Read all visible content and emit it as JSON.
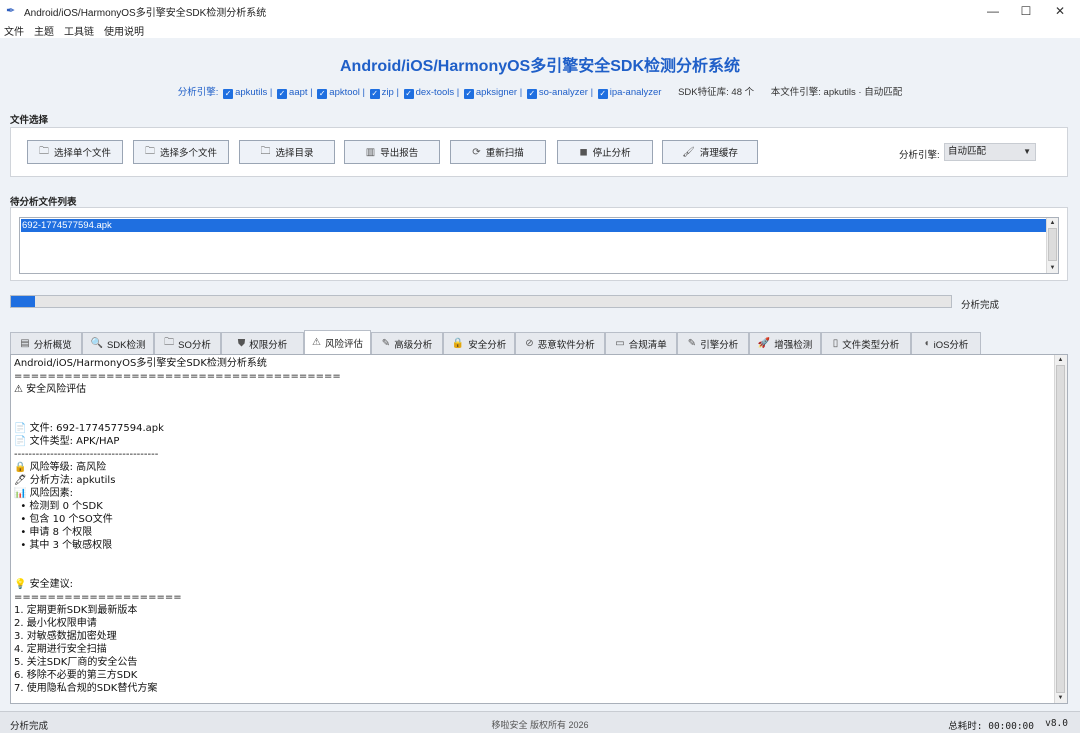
{
  "window": {
    "title": "Android/iOS/HarmonyOS多引擎安全SDK检测分析系统",
    "icon": "feather-icon"
  },
  "menu": [
    "文件",
    "主题",
    "工具链",
    "使用说明"
  ],
  "header": {
    "title": "Android/iOS/HarmonyOS多引擎安全SDK检测分析系统",
    "engines_label": "分析引擎:",
    "engines": [
      "apkutils",
      "aapt",
      "apktool",
      "zip",
      "dex-tools",
      "apksigner",
      "so-analyzer",
      "ipa-analyzer"
    ],
    "sdk_count": "SDK特征库: 48 个",
    "current_engine": "本文件引擎: apkutils · 自动匹配"
  },
  "file_select": {
    "title": "文件选择",
    "buttons": [
      {
        "label": "选择单个文件",
        "icon": "folder-icon"
      },
      {
        "label": "选择多个文件",
        "icon": "folder-icon"
      },
      {
        "label": "选择目录",
        "icon": "folder-icon"
      },
      {
        "label": "导出报告",
        "icon": "chart-icon"
      },
      {
        "label": "重新扫描",
        "icon": "refresh-icon"
      },
      {
        "label": "停止分析",
        "icon": "stop-icon"
      },
      {
        "label": "清理缓存",
        "icon": "broom-icon"
      }
    ],
    "engine_label": "分析引擎:",
    "engine_value": "自动匹配"
  },
  "file_list": {
    "title": "待分析文件列表",
    "items": [
      "692-1774577594.apk"
    ]
  },
  "progress": {
    "percent": 2.5,
    "label": "分析完成"
  },
  "tabs": [
    {
      "label": "分析概览",
      "icon": "overview-icon"
    },
    {
      "label": "SDK检测",
      "icon": "search-icon"
    },
    {
      "label": "SO分析",
      "icon": "folder-icon"
    },
    {
      "label": "权限分析",
      "icon": "shield-icon"
    },
    {
      "label": "风险评估",
      "icon": "warning-icon",
      "active": true
    },
    {
      "label": "高级分析",
      "icon": "pencil-icon"
    },
    {
      "label": "安全分析",
      "icon": "lock-icon"
    },
    {
      "label": "恶意软件分析",
      "icon": "prohibit-icon"
    },
    {
      "label": "合规清单",
      "icon": "clipboard-icon"
    },
    {
      "label": "引擎分析",
      "icon": "pencil-icon"
    },
    {
      "label": "增强检测",
      "icon": "rocket-icon"
    },
    {
      "label": "文件类型分析",
      "icon": "document-icon"
    },
    {
      "label": "iOS分析",
      "icon": "apple-icon"
    }
  ],
  "report": {
    "lines": [
      "Android/iOS/HarmonyOS多引擎安全SDK检测分析系统",
      "=======================================",
      "⚠ 安全风险评估",
      "",
      "",
      "📄 文件: 692-1774577594.apk",
      "📄 文件类型: APK/HAP",
      "----------------------------------------",
      "🔒 风险等级: 高风险",
      "🖊 分析方法: apkutils",
      "📊 风险因素:",
      "  • 检测到 0 个SDK",
      "  • 包含 10 个SO文件",
      "  • 申请 8 个权限",
      "  • 其中 3 个敏感权限",
      "",
      "",
      "💡 安全建议:",
      "====================",
      "1. 定期更新SDK到最新版本",
      "2. 最小化权限申请",
      "3. 对敏感数据加密处理",
      "4. 定期进行安全扫描",
      "5. 关注SDK厂商的安全公告",
      "6. 移除不必要的第三方SDK",
      "7. 使用隐私合规的SDK替代方案"
    ]
  },
  "status": {
    "left": "分析完成",
    "center": "移啦安全 版权所有 2026",
    "time": "总耗时: 00:00:00",
    "version": "v8.0"
  },
  "colors": {
    "accent": "#1f6fe0",
    "title": "#1f5fc8"
  }
}
